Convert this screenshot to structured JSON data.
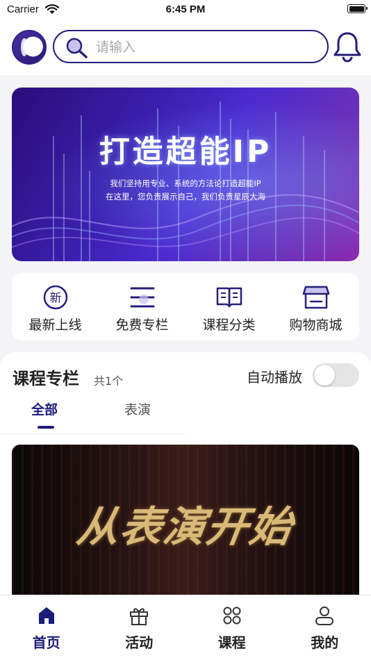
{
  "status_bar": {
    "carrier": "Carrier",
    "time": "6:45 PM"
  },
  "header": {
    "search_placeholder": "请输入"
  },
  "banner": {
    "title": "打造超能IP",
    "subtitle_line1": "我们坚持用专业、系统的方法论打造超能IP",
    "subtitle_line2": "在这里，您负责展示自己，我们负责星辰大海"
  },
  "quick_menu": [
    {
      "label": "最新上线",
      "icon": "new-badge-icon"
    },
    {
      "label": "免费专栏",
      "icon": "list-icon"
    },
    {
      "label": "课程分类",
      "icon": "book-icon"
    },
    {
      "label": "购物商城",
      "icon": "store-icon"
    }
  ],
  "course_section": {
    "title": "课程专栏",
    "count": "共1个",
    "autoplay_label": "自动播放",
    "autoplay_on": false,
    "tabs": [
      {
        "label": "全部",
        "active": true
      },
      {
        "label": "表演",
        "active": false
      }
    ],
    "video_title": "从表演开始"
  },
  "tab_bar": [
    {
      "label": "首页",
      "icon": "home-icon",
      "active": true
    },
    {
      "label": "活动",
      "icon": "gift-icon",
      "active": false
    },
    {
      "label": "课程",
      "icon": "grid-icon",
      "active": false
    },
    {
      "label": "我的",
      "icon": "user-icon",
      "active": false
    }
  ],
  "colors": {
    "accent": "#1b1b7a",
    "background": "#f4f4f6"
  }
}
